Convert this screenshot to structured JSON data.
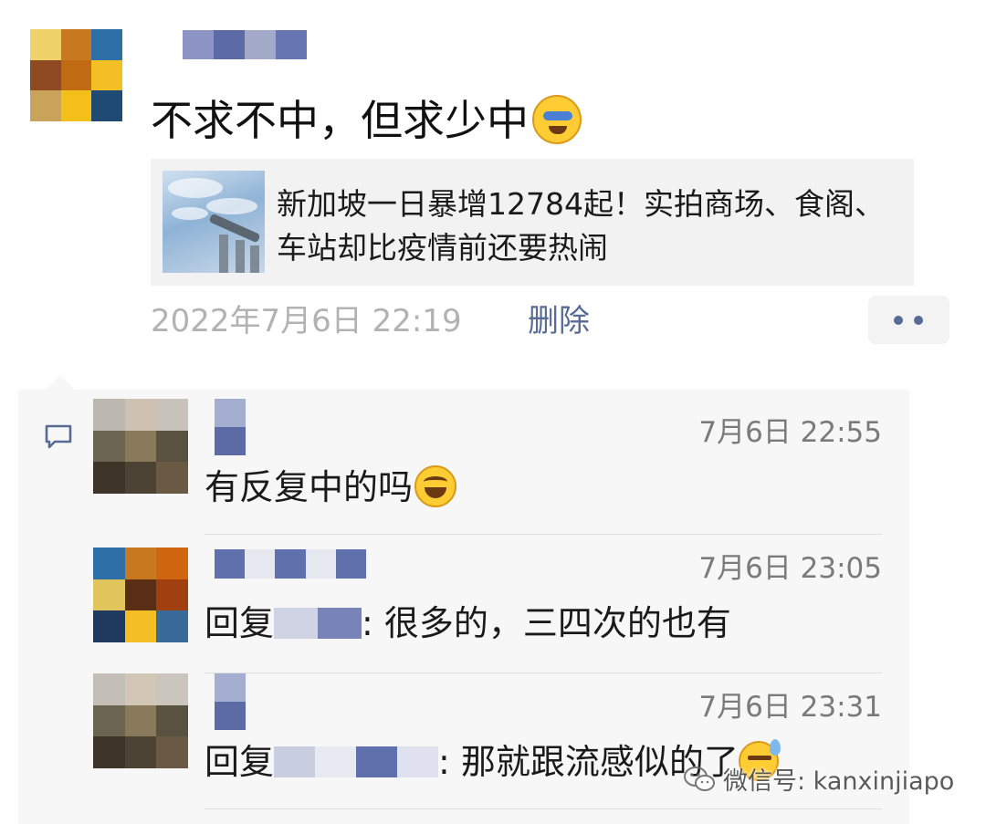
{
  "post": {
    "avatar_colors": [
      "#f0d26a",
      "#c8781e",
      "#2f6fa8",
      "#8f4a22",
      "#c06a12",
      "#f4be25",
      "#c9a35a",
      "#f3bf18",
      "#1f4a74"
    ],
    "name_blur_colors": [
      "#8d95c4",
      "#5d6aa8",
      "#a3aac9",
      "#6775b3"
    ],
    "text": "不求不中，但求少中",
    "emoji_icon": "face-covering-eyes-emoji",
    "link": {
      "title": "新加坡一日暴增12784起！实拍商场、食阁、车站却比疫情前还要热闹",
      "thumbnail_icon": "marina-bay-sands-photo"
    },
    "time": "2022年7月6日 22:19",
    "delete_label": "删除",
    "more_icon": "two-dots-icon"
  },
  "comments": [
    {
      "avatar_colors": [
        "#bdb8b0",
        "#cfc2b2",
        "#c8c4bc",
        "#6a6450",
        "#8a7a5c",
        "#5a5240",
        "#3e3428",
        "#4c4234",
        "#6a5a44"
      ],
      "name_blur_colors": [
        "#a4aed0",
        "#5c6aa6"
      ],
      "time": "7月6日 22:55",
      "text": "有反复中的吗",
      "emoji_icon": "laughing-tears-emoji"
    },
    {
      "avatar_colors": [
        "#2f6fa8",
        "#c8781e",
        "#d0650f",
        "#e2c45c",
        "#5a2e14",
        "#a0400e",
        "#1f3a5e",
        "#f4be25",
        "#3a6a9a"
      ],
      "name_blur_colors": [
        "#6070ac",
        "#e6e8f0",
        "#6070ac",
        "#e6e8f0",
        "#6070ac"
      ],
      "time": "7月6日 23:05",
      "reply_prefix": "回复",
      "reply_blur_colors": [
        "#cfd3e4",
        "#7884b8"
      ],
      "text": ": 很多的，三四次的也有"
    },
    {
      "avatar_colors": [
        "#c4bfb6",
        "#d2c6b6",
        "#cac6be",
        "#6a6450",
        "#8a7a5c",
        "#5a5240",
        "#3e3428",
        "#4c4234",
        "#6a5a44"
      ],
      "name_blur_colors": [
        "#a4aed0",
        "#5c6aa6"
      ],
      "time": "7月6日 23:31",
      "reply_prefix": "回复",
      "reply_blur_colors": [
        "#c8cde0",
        "#e8eaf2",
        "#6070ac",
        "#dfe2ee"
      ],
      "text": ": 那就跟流感似的了",
      "emoji_icon": "sweat-face-emoji"
    }
  ],
  "comment_icon": "comment-bubble-icon",
  "watermark": {
    "icon": "wechat-icon",
    "text": "微信号: kanxinjiapo"
  }
}
